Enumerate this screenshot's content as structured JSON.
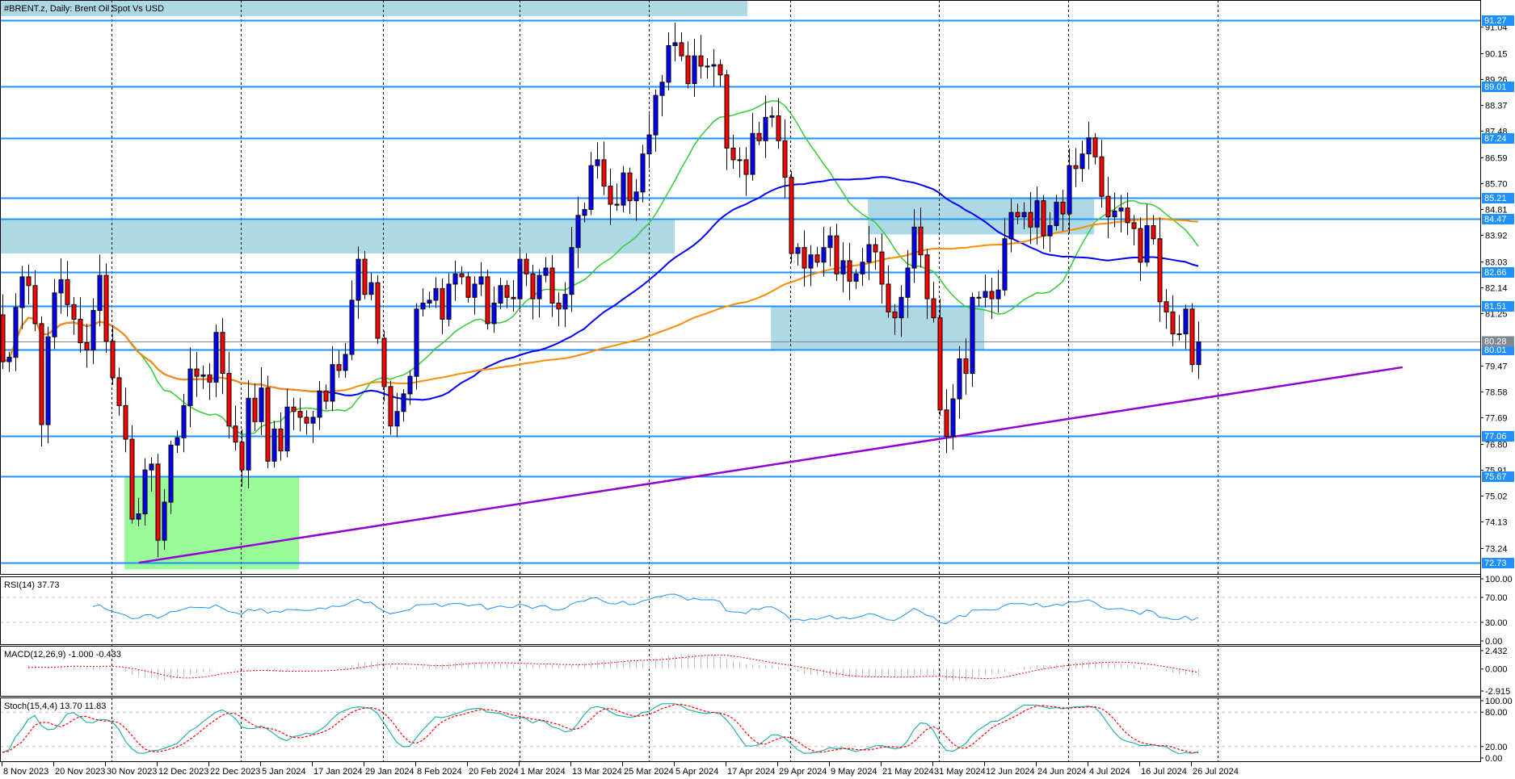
{
  "title": "#BRENT.z, Daily:  Brent Oil Spot Vs USD",
  "colors": {
    "bull": "#0000ff",
    "bear": "#ff0000",
    "level": "#1e90ff",
    "current": "#808890",
    "zone": "#add8e6",
    "green_zone": "#98fb98",
    "trendline": "#9400d3",
    "ma_fast": "#32cd32",
    "ma_mid": "#0000ff",
    "ma_slow": "#ff8c00",
    "rsi": "#1e90ff",
    "stoch_main": "#20b2aa",
    "stoch_signal": "#ff0000",
    "macd_hist": "#c0c0c0",
    "macd_signal": "#ff0000"
  },
  "chart_data": {
    "type": "candlestick",
    "symbol": "#BRENT.z",
    "timeframe": "Daily",
    "ylim": [
      72.5,
      91.96
    ],
    "closes": [
      79.6,
      79.75,
      81.45,
      82.5,
      82.2,
      80.9,
      77.45,
      80.45,
      81.95,
      82.4,
      81.55,
      81.05,
      80.25,
      80.0,
      81.35,
      82.55,
      80.3,
      79.05,
      78.1,
      76.95,
      74.22,
      74.4,
      75.9,
      76.1,
      73.5,
      74.8,
      76.75,
      77.0,
      78.1,
      79.35,
      79.1,
      79.15,
      78.9,
      80.6,
      79.2,
      77.4,
      76.85,
      75.9,
      78.35,
      77.55,
      78.7,
      76.2,
      77.3,
      76.55,
      78.05,
      77.9,
      77.7,
      77.5,
      77.7,
      78.6,
      78.25,
      79.5,
      79.3,
      79.85,
      81.7,
      83.1,
      81.9,
      82.3,
      80.4,
      78.75,
      77.4,
      77.9,
      78.5,
      79.1,
      81.4,
      81.6,
      81.7,
      82.1,
      81.05,
      82.25,
      82.6,
      82.5,
      81.8,
      82.25,
      82.5,
      80.9,
      81.6,
      82.2,
      81.8,
      81.75,
      83.1,
      82.6,
      81.75,
      82.55,
      82.8,
      81.6,
      81.4,
      81.9,
      83.5,
      84.6,
      84.8,
      86.3,
      86.5,
      85.6,
      84.98,
      84.95,
      86.05,
      85.1,
      85.4,
      86.7,
      87.35,
      88.7,
      89.15,
      90.4,
      90.5,
      90.05,
      89.1,
      90.05,
      89.7,
      89.7,
      89.75,
      89.4,
      86.9,
      86.5,
      86.5,
      86.0,
      87.4,
      87.15,
      87.95,
      88.0,
      87.15,
      85.9,
      83.3,
      83.5,
      82.8,
      83.25,
      83.0,
      83.5,
      83.9,
      82.6,
      83.05,
      82.35,
      82.6,
      83.0,
      83.6,
      83.35,
      82.25,
      81.3,
      81.1,
      81.8,
      82.8,
      84.2,
      83.25,
      81.75,
      81.1,
      77.95,
      77.05,
      78.33,
      79.7,
      79.2,
      81.8,
      81.8,
      82.0,
      81.75,
      82.05,
      83.8,
      84.7,
      84.55,
      84.7,
      84.2,
      85.1,
      83.9,
      84.25,
      85.05,
      84.65,
      86.3,
      86.2,
      86.7,
      87.25,
      86.6,
      85.25,
      84.55,
      84.75,
      84.85,
      84.35,
      84.15,
      83.0,
      84.25,
      83.8,
      81.65,
      81.3,
      80.55,
      80.55,
      81.4,
      79.5,
      80.28
    ],
    "current_price": "80.28",
    "levels": [
      "91.27",
      "89.01",
      "87.24",
      "85.21",
      "84.47",
      "82.66",
      "81.51",
      "80.01",
      "77.06",
      "75.67",
      "72.73"
    ],
    "price_ticks": [
      "91.04",
      "90.15",
      "89.26",
      "88.37",
      "87.48",
      "86.59",
      "85.70",
      "84.81",
      "83.92",
      "83.03",
      "82.14",
      "81.25",
      "79.47",
      "78.58",
      "77.69",
      "76.80",
      "75.91",
      "75.02",
      "74.13",
      "73.24"
    ],
    "date_ticks": [
      {
        "bar": 0,
        "label": "8 Nov 2023"
      },
      {
        "bar": 8,
        "label": "20 Nov 2023"
      },
      {
        "bar": 16,
        "label": "30 Nov 2023"
      },
      {
        "bar": 24,
        "label": "12 Dec 2023"
      },
      {
        "bar": 32,
        "label": "22 Dec 2023"
      },
      {
        "bar": 40,
        "label": "5 Jan 2024"
      },
      {
        "bar": 48,
        "label": "17 Jan 2024"
      },
      {
        "bar": 56,
        "label": "29 Jan 2024"
      },
      {
        "bar": 64,
        "label": "8 Feb 2024"
      },
      {
        "bar": 72,
        "label": "20 Feb 2024"
      },
      {
        "bar": 80,
        "label": "1 Mar 2024"
      },
      {
        "bar": 88,
        "label": "13 Mar 2024"
      },
      {
        "bar": 96,
        "label": "25 Mar 2024"
      },
      {
        "bar": 104,
        "label": "5 Apr 2024"
      },
      {
        "bar": 112,
        "label": "17 Apr 2024"
      },
      {
        "bar": 120,
        "label": "29 Apr 2024"
      },
      {
        "bar": 128,
        "label": "9 May 2024"
      },
      {
        "bar": 136,
        "label": "21 May 2024"
      },
      {
        "bar": 144,
        "label": "31 May 2024"
      },
      {
        "bar": 152,
        "label": "12 Jun 2024"
      },
      {
        "bar": 160,
        "label": "24 Jun 2024"
      },
      {
        "bar": 168,
        "label": "4 Jul 2024"
      },
      {
        "bar": 176,
        "label": "16 Jul 2024"
      },
      {
        "bar": 184,
        "label": "26 Jul 2024"
      }
    ],
    "zones": [
      {
        "name": "resistance-zone-upper",
        "bars": [
          -0.4,
          104
        ],
        "prices": [
          84.47,
          83.3
        ],
        "color": "zone"
      },
      {
        "name": "resistance-zone-june",
        "bars": [
          133.9,
          168.9
        ],
        "prices": [
          85.21,
          83.95
        ],
        "color": "zone"
      },
      {
        "name": "support-zone-may",
        "bars": [
          118.9,
          151.9
        ],
        "prices": [
          81.51,
          80.01
        ],
        "color": "zone"
      },
      {
        "name": "support-zone-december",
        "bars": [
          18.9,
          45.9
        ],
        "prices": [
          75.67,
          72.5
        ],
        "color": "green_zone"
      }
    ],
    "trendline": {
      "from": {
        "bar": 21.1,
        "price": 72.73
      },
      "to": {
        "bar": 216.6,
        "price": 79.41
      }
    },
    "moving_averages": [
      {
        "period": 20,
        "color": "ma_fast"
      },
      {
        "period": 50,
        "color": "ma_mid"
      },
      {
        "period": 100,
        "color": "ma_slow"
      }
    ]
  },
  "indicators": {
    "rsi": {
      "label": "RSI(14) 37.73",
      "period": 14,
      "ticks": [
        "100.00",
        "70.00",
        "30.00",
        "0.00"
      ]
    },
    "macd": {
      "label": "MACD(12,26,9) -1.000 -0.433",
      "ticks": [
        "2.432",
        "0.000",
        "-2.915"
      ],
      "range": [
        -2.915,
        2.432
      ]
    },
    "stoch": {
      "label": "Stoch(15,4,4) 13.70 11.83",
      "ticks": [
        "100.00",
        "80.00",
        "20.00",
        "0.00"
      ]
    }
  }
}
